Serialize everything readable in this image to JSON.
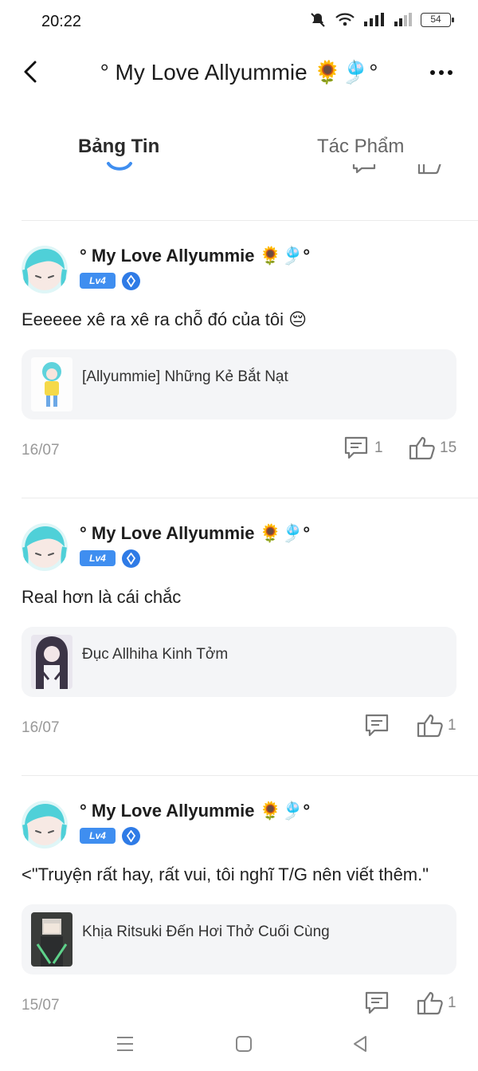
{
  "status_bar": {
    "time": "20:22",
    "battery": "54"
  },
  "header": {
    "title": "° My Love Allyummie 🌻🎐°"
  },
  "tabs": [
    {
      "label": "Bảng Tin",
      "active": true
    },
    {
      "label": "Tác Phẩm",
      "active": false
    }
  ],
  "posts": [
    {
      "author": "° My Love Allyummie 🌻🎐°",
      "level": "Lv4",
      "text": "Eeeeee xê ra xê ra chỗ đó của tôi 😔",
      "story_title": "[Allyummie] Những Kẻ Bắt Nạt",
      "date": "16/07",
      "comments": "1",
      "likes": "15"
    },
    {
      "author": "° My Love Allyummie 🌻🎐°",
      "level": "Lv4",
      "text": "Real hơn là cái chắc",
      "story_title": "Đục Allhiha Kinh Tởm",
      "date": "16/07",
      "comments": "",
      "likes": "1"
    },
    {
      "author": "° My Love Allyummie 🌻🎐°",
      "level": "Lv4",
      "text": "<\"Truyện rất hay, rất vui, tôi nghĩ T/G nên viết thêm.\"",
      "story_title": "Khịa Ritsuki Đến Hơi Thở Cuối Cùng",
      "date": "15/07",
      "comments": "",
      "likes": "1"
    }
  ],
  "colors": {
    "accent": "#3f8ef0",
    "muted": "#999999",
    "card_bg": "#f4f5f7"
  },
  "icons": [
    "back-icon",
    "more-icon",
    "comment-icon",
    "like-icon",
    "vip-icon",
    "menu-icon",
    "home-icon",
    "back-triangle-icon"
  ]
}
